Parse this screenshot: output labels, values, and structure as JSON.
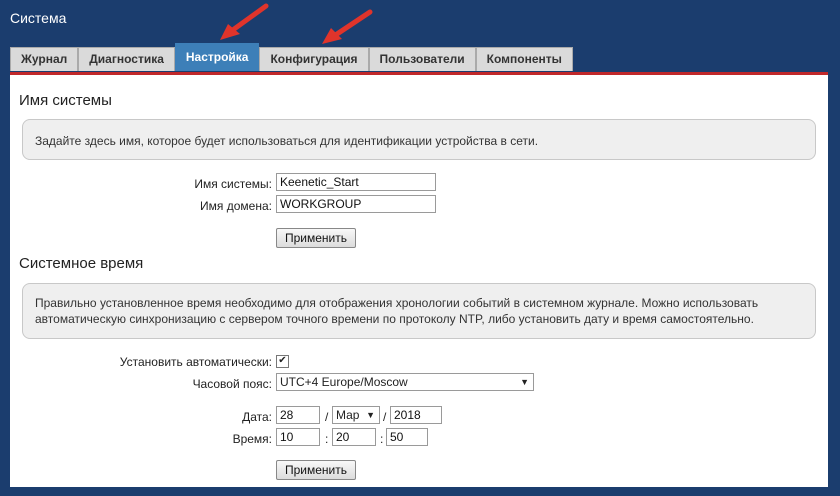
{
  "window": {
    "title": "Система"
  },
  "tabs": [
    {
      "label": "Журнал"
    },
    {
      "label": "Диагностика"
    },
    {
      "label": "Настройка"
    },
    {
      "label": "Конфигурация"
    },
    {
      "label": "Пользователи"
    },
    {
      "label": "Компоненты"
    }
  ],
  "active_tab": "Настройка",
  "system_name_section": {
    "title": "Имя системы",
    "info": "Задайте здесь имя, которое будет использоваться для идентификации устройства в сети.",
    "system_name_label": "Имя системы:",
    "system_name_value": "Keenetic_Start",
    "domain_label": "Имя домена:",
    "domain_value": "WORKGROUP",
    "apply_label": "Применить"
  },
  "system_time_section": {
    "title": "Системное время",
    "info": "Правильно установленное время необходимо для отображения хронологии событий в системном журнале. Можно использовать автоматическую синхронизацию с сервером точного времени по протоколу NTP, либо установить дату и время самостоятельно.",
    "auto_label": "Установить автоматически:",
    "auto_checked": true,
    "timezone_label": "Часовой пояс:",
    "timezone_value": "UTC+4 Europe/Moscow",
    "date_label": "Дата:",
    "date_day": "28",
    "date_month": "Мар",
    "date_year": "2018",
    "date_sep": "/",
    "time_label": "Время:",
    "time_h": "10",
    "time_m": "20",
    "time_s": "50",
    "time_sep": ":",
    "apply_label": "Применить"
  },
  "colors": {
    "background": "#1b3d6e",
    "active_tab": "#3d7fb8",
    "accent_line": "#c0282a",
    "arrows": "#e0342b"
  }
}
